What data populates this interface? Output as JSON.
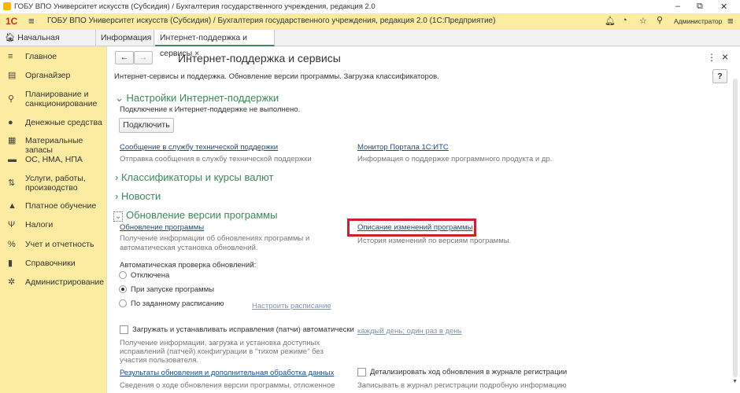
{
  "window": {
    "title": "ГОБУ ВПО Университет искусств (Субсидия) / Бухгалтерия государственного учреждения, редакция 2.0",
    "min": "–",
    "restore": "⧉",
    "close": "✕"
  },
  "header": {
    "logo": "1С",
    "title": "ГОБУ ВПО Университет искусств (Субсидия) / Бухгалтерия государственного учреждения, редакция 2.0  (1С:Предприятие)",
    "user": "Администратор"
  },
  "tabs": [
    {
      "label": "Начальная страница"
    },
    {
      "label": "Информация"
    },
    {
      "label": "Интернет-поддержка и сервисы"
    }
  ],
  "sidebar": {
    "items": [
      {
        "label": "Главное",
        "icon": "≡"
      },
      {
        "label": "Органайзер",
        "icon": "▤"
      },
      {
        "label": "Планирование и санкционирование",
        "icon": "⚲"
      },
      {
        "label": "Денежные средства",
        "icon": "●"
      },
      {
        "label": "Материальные запасы",
        "icon": "▦"
      },
      {
        "label": "ОС, НМА, НПА",
        "icon": "▬"
      },
      {
        "label": "Услуги, работы, производство",
        "icon": "⇅"
      },
      {
        "label": "Платное обучение",
        "icon": "▲"
      },
      {
        "label": "Налоги",
        "icon": "Ψ"
      },
      {
        "label": "Учет и отчетность",
        "icon": "%"
      },
      {
        "label": "Справочники",
        "icon": "▮"
      },
      {
        "label": "Администрирование",
        "icon": "✲"
      }
    ]
  },
  "content": {
    "title": "Интернет-поддержка и сервисы",
    "description": "Интернет-сервисы и поддержка. Обновление версии программы. Загрузка классификаторов.",
    "help": "?",
    "more": "⋮",
    "close": "×",
    "support": {
      "heading": "Настройки Интернет-поддержки",
      "status": "Подключение к Интернет-поддержке не выполнено.",
      "connect": "Подключить",
      "link1": "Сообщение в службу технической поддержки",
      "link1_desc": "Отправка сообщения в службу технической поддержки",
      "link2": "Монитор Портала 1С:ИТС",
      "link2_desc": "Информация о поддержке программного продукта и др."
    },
    "classifiers": "Классификаторы и курсы валют",
    "news": "Новости",
    "update": {
      "heading": "Обновление версии программы",
      "link1": "Обновление программы",
      "link1_desc1": "Получение информации об обновлениях программы и",
      "link1_desc2": "автоматическая установка обновлений.",
      "link2": "Описание изменений программы",
      "link2_desc": "История изменений по версиям программы.",
      "auto_label": "Автоматическая проверка обновлений:",
      "options": [
        "Отключена",
        "При запуске программы",
        "По заданному расписанию"
      ],
      "selected": 1,
      "schedule": "Настроить расписание",
      "patches": "Загружать и устанавливать исправления (патчи) автоматически",
      "patches_schedule": "каждый день; один раз в день",
      "patches_desc1": "Получение информации, загрузка и установка доступных",
      "patches_desc2": "исправлений (патчей) конфигурации в \"тихом режиме\" без",
      "patches_desc3": "участия пользователя.",
      "results": "Результаты обновления и дополнительная обработка данных",
      "results_desc": "Сведения о ходе обновления версии программы, отложенное",
      "detail": "Детализировать ход обновления в журнале регистрации",
      "detail_desc": "Записывать в журнал регистрации подробную информацию"
    }
  }
}
